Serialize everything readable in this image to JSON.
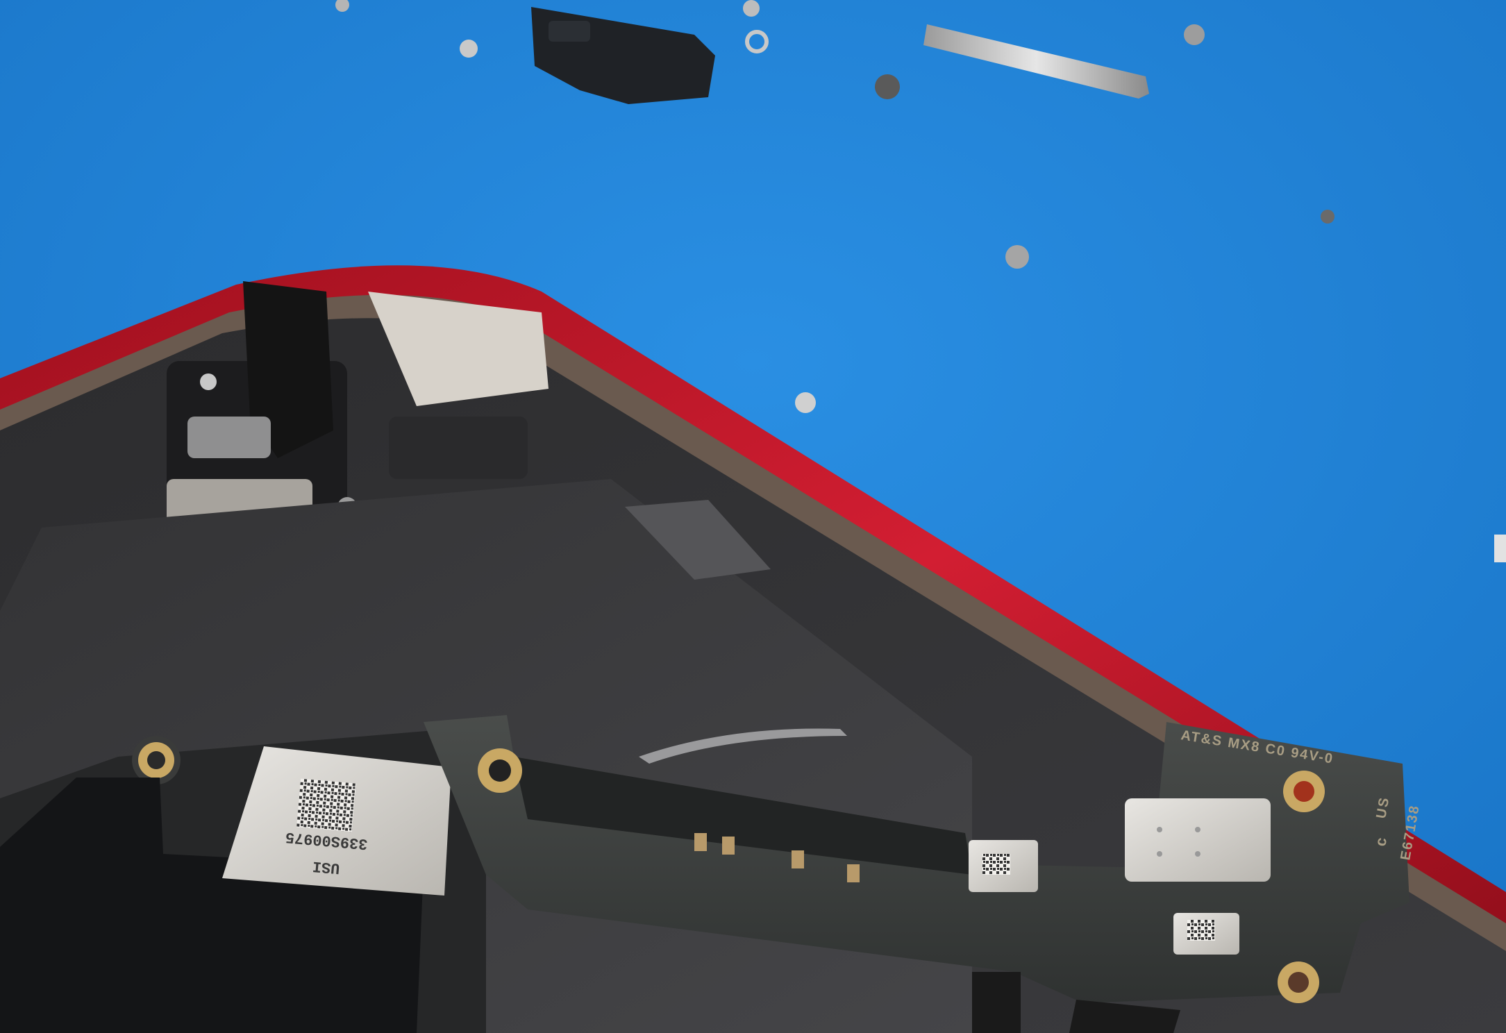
{
  "photo": {
    "mat_color": "#1a7fd3",
    "frame_color": "#c0182a",
    "board_color": "#3a3d3c"
  },
  "board_markings": {
    "module_line1": "USI",
    "module_line2": "339S00975",
    "pcb_line1": "AT&S MX8 C0 94V-0",
    "ul_mark": "c",
    "ul_us": "US",
    "ul_code": "E67138"
  }
}
